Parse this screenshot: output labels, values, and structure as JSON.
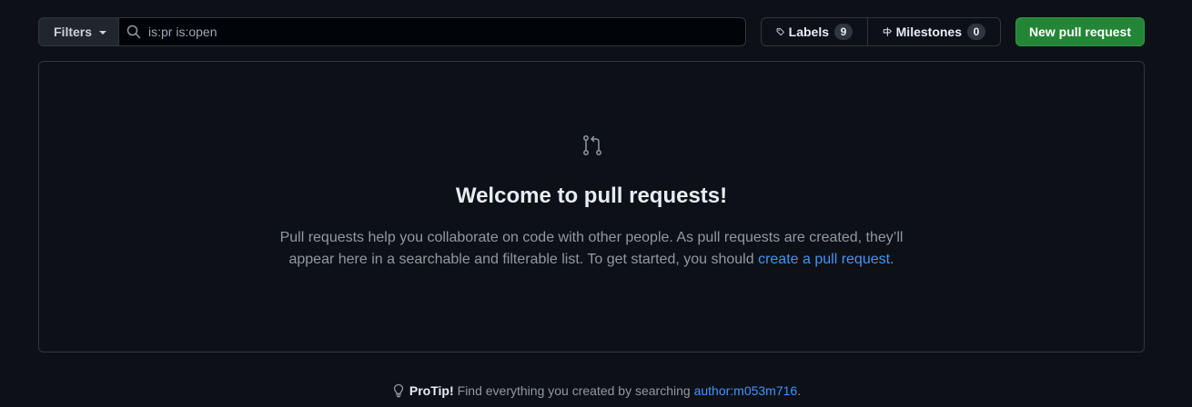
{
  "toolbar": {
    "filters_label": "Filters",
    "search_value": "is:pr is:open",
    "labels_label": "Labels",
    "labels_count": "9",
    "milestones_label": "Milestones",
    "milestones_count": "0",
    "new_pr_label": "New pull request"
  },
  "blankslate": {
    "title": "Welcome to pull requests!",
    "description_part1": "Pull requests help you collaborate on code with other people. As pull requests are created, they’ll appear here in a searchable and filterable list. To get started, you should ",
    "link_text": "create a pull request",
    "description_end": "."
  },
  "protip": {
    "label": "ProTip!",
    "text": "Find everything you created by searching ",
    "link_text": "author:m053m716",
    "end": "."
  },
  "icons": {
    "search": "search-icon",
    "tag": "tag-icon",
    "milestone": "milestone-icon",
    "pull_request": "git-pull-request-icon",
    "light_bulb": "light-bulb-icon"
  },
  "colors": {
    "background": "#0d1117",
    "border": "#30363d",
    "accent_green": "#238636",
    "link": "#4493f8",
    "muted_text": "#9198a1"
  }
}
